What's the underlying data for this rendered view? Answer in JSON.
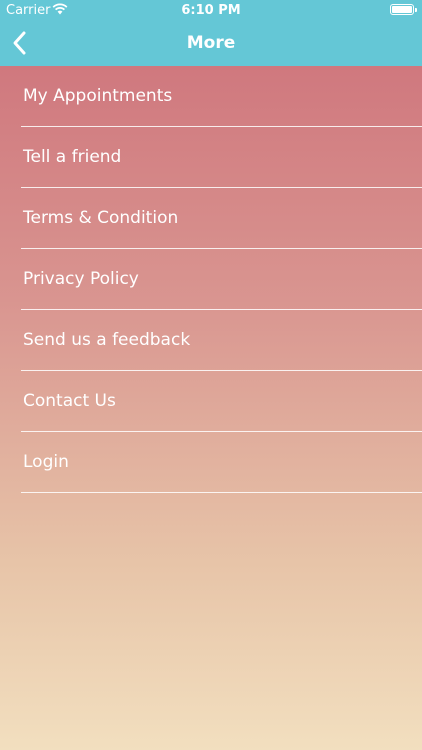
{
  "status_bar": {
    "carrier": "Carrier",
    "time": "6:10 PM",
    "wifi_icon": "wifi-icon",
    "battery_icon": "battery-icon"
  },
  "nav": {
    "title": "More",
    "back_icon": "chevron-left-icon"
  },
  "menu": {
    "items": [
      {
        "label": "My Appointments"
      },
      {
        "label": "Tell a friend"
      },
      {
        "label": "Terms & Condition"
      },
      {
        "label": "Privacy Policy"
      },
      {
        "label": "Send us a feedback"
      },
      {
        "label": "Contact Us"
      },
      {
        "label": "Login"
      }
    ]
  },
  "colors": {
    "header": "#64c7d6",
    "gradient_top": "#cd7079",
    "gradient_bottom": "#f2dfbf"
  }
}
